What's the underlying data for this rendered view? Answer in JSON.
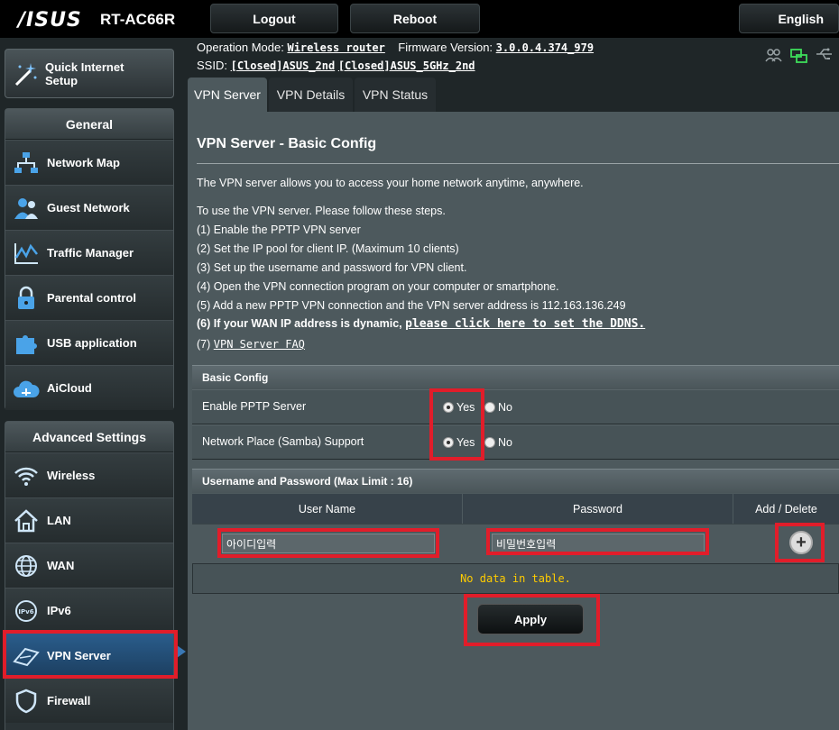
{
  "header": {
    "logo": "/ISUS",
    "model": "RT-AC66R",
    "logout_label": "Logout",
    "reboot_label": "Reboot",
    "language_label": "English"
  },
  "info": {
    "operation_mode_label": "Operation Mode:",
    "operation_mode_value": "Wireless router",
    "firmware_label": "Firmware Version:",
    "firmware_value": "3.0.0.4.374_979",
    "ssid_label": "SSID:",
    "ssid_1": "[Closed]ASUS_2nd",
    "ssid_2": "[Closed]ASUS_5GHz_2nd"
  },
  "sidebar": {
    "quick_setup_label": "Quick Internet Setup",
    "general_title": "General",
    "general_items": [
      {
        "label": "Network Map"
      },
      {
        "label": "Guest Network"
      },
      {
        "label": "Traffic Manager"
      },
      {
        "label": "Parental control"
      },
      {
        "label": "USB application"
      },
      {
        "label": "AiCloud"
      }
    ],
    "advanced_title": "Advanced Settings",
    "advanced_items": [
      {
        "label": "Wireless"
      },
      {
        "label": "LAN"
      },
      {
        "label": "WAN"
      },
      {
        "label": "IPv6"
      },
      {
        "label": "VPN Server"
      },
      {
        "label": "Firewall"
      }
    ]
  },
  "tabs": [
    {
      "label": "VPN Server"
    },
    {
      "label": "VPN Details"
    },
    {
      "label": "VPN Status"
    }
  ],
  "main": {
    "title": "VPN Server - Basic Config",
    "intro": "The VPN server allows you to access your home network anytime, anywhere.",
    "steps_intro": "To use the VPN server. Please follow these steps.",
    "step1": "(1) Enable the PPTP VPN server",
    "step2": "(2) Set the IP pool for client IP. (Maximum 10 clients)",
    "step3": "(3) Set up the username and password for VPN client.",
    "step4": "(4) Open the VPN connection program on your computer or smartphone.",
    "step5": "(5) Add a new PPTP VPN connection and the VPN server address is 112.163.136.249",
    "step6_text": "(6) If your WAN IP address is dynamic,",
    "step6_link": "please click here to set the DDNS.",
    "step7_prefix": "(7)",
    "step7_link": "VPN Server FAQ"
  },
  "basic_config": {
    "header": "Basic Config",
    "pptp_label": "Enable PPTP Server",
    "samba_label": "Network Place (Samba) Support",
    "yes_label": "Yes",
    "no_label": "No"
  },
  "users": {
    "header": "Username and Password (Max Limit : 16)",
    "col_username": "User Name",
    "col_password": "Password",
    "col_add_delete": "Add / Delete",
    "username_value": "아이디입력",
    "password_value": "비밀번호입력",
    "no_data": "No data in table."
  },
  "apply_label": "Apply",
  "colors": {
    "highlight": "#e11d2a",
    "no_data": "#ffcc00",
    "active_menu": "#2a5d8c"
  }
}
